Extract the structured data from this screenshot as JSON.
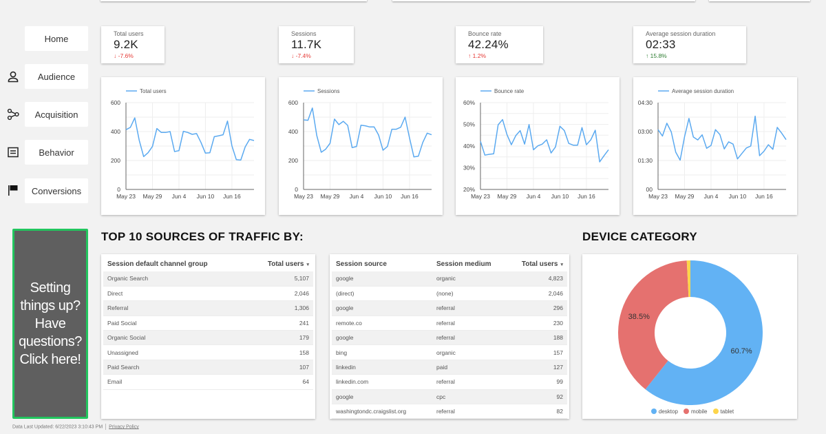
{
  "nav": {
    "items": [
      {
        "label": "Home",
        "icon": "none"
      },
      {
        "label": "Audience",
        "icon": "person-icon"
      },
      {
        "label": "Acquisition",
        "icon": "share-nodes-icon"
      },
      {
        "label": "Behavior",
        "icon": "document-lines-icon"
      },
      {
        "label": "Conversions",
        "icon": "flag-icon"
      }
    ]
  },
  "kpis": [
    {
      "label": "Total users",
      "value": "9.2K",
      "change": "-7.6%",
      "direction": "down",
      "color": "#e53935"
    },
    {
      "label": "Sessions",
      "value": "11.7K",
      "change": "-7.4%",
      "direction": "down",
      "color": "#e53935"
    },
    {
      "label": "Bounce rate",
      "value": "42.24%",
      "change": "1.2%",
      "direction": "up",
      "color": "#e53935"
    },
    {
      "label": "Average session duration",
      "value": "02:33",
      "change": "15.8%",
      "direction": "up",
      "color": "#2e7d32"
    }
  ],
  "chart_data": [
    {
      "type": "line",
      "title": "",
      "legend": [
        "Total users"
      ],
      "legend_position": "top-left",
      "xlabel": "",
      "ylabel": "",
      "x_ticks": [
        "May 23",
        "May 29",
        "Jun 4",
        "Jun 10",
        "Jun 16"
      ],
      "y_ticks": [
        "0",
        "200",
        "400",
        "600"
      ],
      "ylim": [
        0,
        600
      ],
      "grid": true,
      "series": [
        {
          "name": "Total users",
          "color": "#5aa9f0",
          "values": [
            413,
            429,
            495,
            341,
            227,
            254,
            297,
            421,
            394,
            394,
            400,
            262,
            268,
            402,
            394,
            381,
            386,
            325,
            251,
            254,
            365,
            371,
            378,
            473,
            302,
            206,
            203,
            294,
            346,
            338
          ]
        }
      ]
    },
    {
      "type": "line",
      "title": "",
      "legend": [
        "Sessions"
      ],
      "legend_position": "top-left",
      "xlabel": "",
      "ylabel": "",
      "x_ticks": [
        "May 23",
        "May 29",
        "Jun 4",
        "Jun 10",
        "Jun 16"
      ],
      "y_ticks": [
        "0",
        "200",
        "400",
        "600"
      ],
      "ylim": [
        0,
        600
      ],
      "grid": true,
      "series": [
        {
          "name": "Sessions",
          "color": "#5aa9f0",
          "values": [
            481,
            478,
            563,
            373,
            257,
            278,
            319,
            486,
            448,
            471,
            443,
            289,
            297,
            444,
            440,
            432,
            432,
            376,
            271,
            297,
            416,
            416,
            430,
            500,
            357,
            225,
            230,
            325,
            389,
            378
          ]
        }
      ]
    },
    {
      "type": "line",
      "title": "",
      "legend": [
        "Bounce rate"
      ],
      "legend_position": "top-left",
      "xlabel": "",
      "ylabel": "",
      "x_ticks": [
        "May 23",
        "May 29",
        "Jun 4",
        "Jun 10",
        "Jun 16"
      ],
      "y_ticks": [
        "20%",
        "30%",
        "40%",
        "50%",
        "60%"
      ],
      "ylim": [
        20,
        60
      ],
      "grid": true,
      "series": [
        {
          "name": "Bounce rate",
          "color": "#5aa9f0",
          "values": [
            42.2,
            35.8,
            36.2,
            36.4,
            49.8,
            52.2,
            45.3,
            40.6,
            44.8,
            47.1,
            40.9,
            49.9,
            38.3,
            40.1,
            40.9,
            42.9,
            36.8,
            39.6,
            49.1,
            47.1,
            41.2,
            40.4,
            40.4,
            48.5,
            40.6,
            42.9,
            47.3,
            32.7,
            35.6,
            38.3
          ]
        }
      ]
    },
    {
      "type": "line",
      "title": "",
      "legend": [
        "Average session duration"
      ],
      "legend_position": "top-left",
      "xlabel": "",
      "ylabel": "",
      "x_ticks": [
        "May 23",
        "May 29",
        "Jun 4",
        "Jun 10",
        "Jun 16"
      ],
      "y_ticks": [
        "00",
        "01:30",
        "03:00",
        "04:30"
      ],
      "ylim": [
        0,
        270
      ],
      "y_unit": "seconds",
      "grid": true,
      "series": [
        {
          "name": "Average session duration",
          "color": "#5aa9f0",
          "values": [
            186,
            166,
            206,
            179,
            116,
            91,
            164,
            221,
            163,
            154,
            170,
            128,
            137,
            186,
            171,
            126,
            148,
            141,
            95,
            112,
            129,
            135,
            228,
            105,
            119,
            139,
            125,
            193,
            175,
            155
          ]
        }
      ]
    },
    {
      "type": "pie",
      "title": "DEVICE CATEGORY",
      "donut": true,
      "legend_position": "bottom",
      "categories": [
        "desktop",
        "mobile",
        "tablet"
      ],
      "values": [
        60.7,
        38.5,
        0.8
      ],
      "labels": [
        "60.7%",
        "38.5%",
        ""
      ],
      "colors": [
        "#62b2f4",
        "#e5716f",
        "#fdd54b"
      ]
    }
  ],
  "cta": {
    "label": "Setting things up? Have questions? Click here!",
    "border_color": "#22c55e"
  },
  "traffic": {
    "title": "TOP 10 SOURCES OF TRAFFIC BY:",
    "channel_table": {
      "headers": [
        "Session default channel group",
        "Total users"
      ],
      "sort_icon": "▾",
      "rows": [
        [
          "Organic Search",
          "5,107"
        ],
        [
          "Direct",
          "2,046"
        ],
        [
          "Referral",
          "1,306"
        ],
        [
          "Paid Social",
          "241"
        ],
        [
          "Organic Social",
          "179"
        ],
        [
          "Unassigned",
          "158"
        ],
        [
          "Paid Search",
          "107"
        ],
        [
          "Email",
          "64"
        ]
      ]
    },
    "source_table": {
      "headers": [
        "Session source",
        "Session medium",
        "Total users"
      ],
      "sort_icon": "▾",
      "rows": [
        [
          "google",
          "organic",
          "4,823"
        ],
        [
          "(direct)",
          "(none)",
          "2,046"
        ],
        [
          "google",
          "referral",
          "296"
        ],
        [
          "remote.co",
          "referral",
          "230"
        ],
        [
          "google",
          "referral",
          "188"
        ],
        [
          "bing",
          "organic",
          "157"
        ],
        [
          "linkedin",
          "paid",
          "127"
        ],
        [
          "linkedin.com",
          "referral",
          "99"
        ],
        [
          "google",
          "cpc",
          "92"
        ],
        [
          "washingtondc.craigslist.org",
          "referral",
          "82"
        ]
      ]
    }
  },
  "device": {
    "title": "DEVICE CATEGORY"
  },
  "footer": {
    "updated": "Data Last Updated: 6/22/2023 3:10:43 PM",
    "privacy": "Privacy Policy"
  }
}
